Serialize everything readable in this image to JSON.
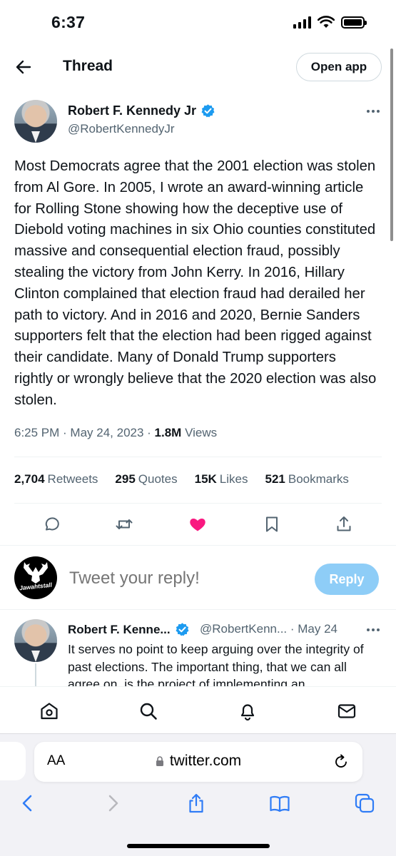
{
  "status_bar": {
    "time": "6:37"
  },
  "header": {
    "title": "Thread",
    "open_app_label": "Open app"
  },
  "tweet": {
    "author_name": "Robert F. Kennedy Jr",
    "author_handle": "@RobertKennedyJr",
    "text": "Most Democrats agree that the 2001 election was stolen from Al Gore. In 2005, I wrote an award-winning article for Rolling Stone showing how the deceptive use of Diebold voting machines in six Ohio counties constituted massive and consequential election fraud, possibly stealing the victory from John Kerry. In 2016, Hillary Clinton complained that election fraud had derailed her path to victory. And in 2016 and 2020, Bernie Sanders supporters felt that the election had been rigged against their candidate. Many of Donald Trump supporters rightly or wrongly believe that the 2020 election was also stolen.",
    "time": "6:25 PM",
    "date": "May 24, 2023",
    "views_count": "1.8M",
    "views_label": "Views",
    "stats": {
      "retweets_count": "2,704",
      "retweets_label": "Retweets",
      "quotes_count": "295",
      "quotes_label": "Quotes",
      "likes_count": "15K",
      "likes_label": "Likes",
      "bookmarks_count": "521",
      "bookmarks_label": "Bookmarks"
    },
    "liked": true,
    "like_color": "#f91880"
  },
  "reply": {
    "avatar_text": "Jawahtstall",
    "placeholder": "Tweet your reply!",
    "button_label": "Reply"
  },
  "second_tweet": {
    "author_name": "Robert F. Kenne...",
    "handle_date": "@RobertKenn... · May 24",
    "text": "It serves no point to keep arguing over the integrity of past elections. The important thing, that we can all agree on, is the project of implementing an"
  },
  "browser": {
    "text_size_label": "AA",
    "url": "twitter.com"
  },
  "colors": {
    "accent": "#1d9bf0",
    "reply_button": "#8ecdf7",
    "safari_blue": "#2f7cf6"
  }
}
